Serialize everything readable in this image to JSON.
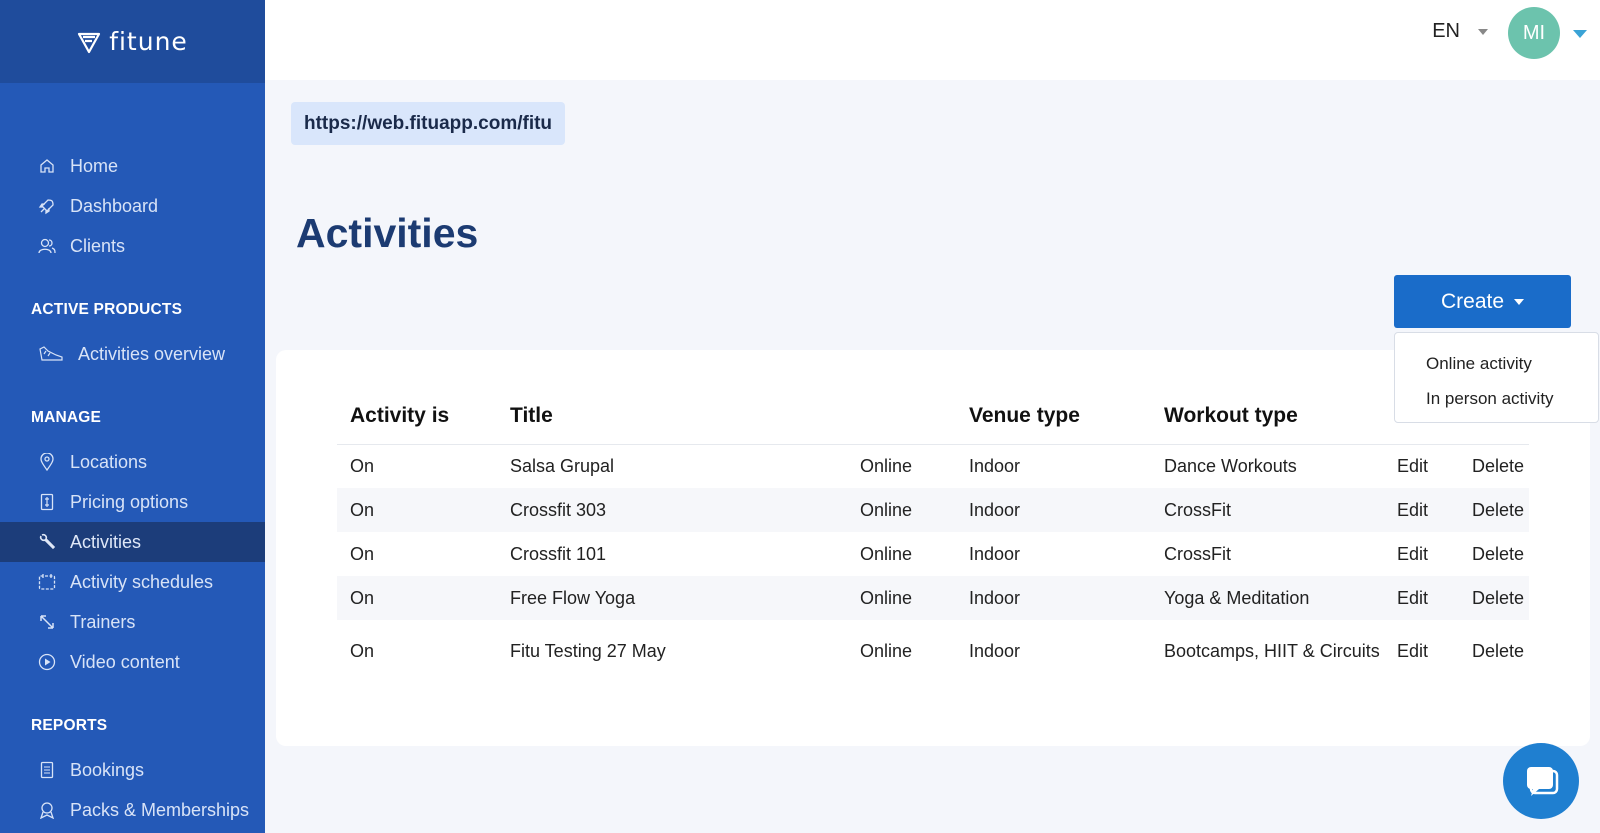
{
  "brand": {
    "name": "fitune"
  },
  "topbar": {
    "language": "EN",
    "avatar_initials": "MI"
  },
  "sidebar": {
    "items_top": [
      {
        "label": "Home",
        "icon": "home-icon"
      },
      {
        "label": "Dashboard",
        "icon": "rocket-icon"
      },
      {
        "label": "Clients",
        "icon": "users-icon"
      }
    ],
    "section_active_products": "ACTIVE PRODUCTS",
    "items_products": [
      {
        "label": "Activities overview",
        "icon": "sneaker-icon"
      }
    ],
    "section_manage": "MANAGE",
    "items_manage": [
      {
        "label": "Locations",
        "icon": "location-pin-icon"
      },
      {
        "label": "Pricing options",
        "icon": "price-tag-icon"
      },
      {
        "label": "Activities",
        "icon": "wrench-icon",
        "active": true
      },
      {
        "label": "Activity schedules",
        "icon": "calendar-icon"
      },
      {
        "label": "Trainers",
        "icon": "expand-arrows-icon"
      },
      {
        "label": "Video content",
        "icon": "play-circle-icon"
      }
    ],
    "section_reports": "REPORTS",
    "items_reports": [
      {
        "label": "Bookings",
        "icon": "clipboard-icon"
      },
      {
        "label": "Packs & Memberships",
        "icon": "award-icon"
      }
    ]
  },
  "main": {
    "url": "https://web.fituapp.com/fitu",
    "title": "Activities",
    "create_label": "Create",
    "create_menu": [
      "Online activity",
      "In person activity"
    ]
  },
  "table": {
    "headers": [
      "Activity is",
      "Title",
      "",
      "Venue type",
      "Workout type",
      "",
      ""
    ],
    "rows": [
      {
        "status": "On",
        "title": "Salsa Grupal",
        "mode": "Online",
        "venue": "Indoor",
        "workout": "Dance Workouts",
        "edit": "Edit",
        "delete": "Delete"
      },
      {
        "status": "On",
        "title": "Crossfit 303",
        "mode": "Online",
        "venue": "Indoor",
        "workout": "CrossFit",
        "edit": "Edit",
        "delete": "Delete"
      },
      {
        "status": "On",
        "title": "Crossfit 101",
        "mode": "Online",
        "venue": "Indoor",
        "workout": "CrossFit",
        "edit": "Edit",
        "delete": "Delete"
      },
      {
        "status": "On",
        "title": "Free Flow Yoga",
        "mode": "Online",
        "venue": "Indoor",
        "workout": "Yoga & Meditation",
        "edit": "Edit",
        "delete": "Delete"
      },
      {
        "status": "On",
        "title": "Fitu Testing 27 May",
        "mode": "Online",
        "venue": "Indoor",
        "workout": "Bootcamps, HIIT & Circuits",
        "edit": "Edit",
        "delete": "Delete"
      }
    ]
  },
  "colors": {
    "sidebar": "#2459b7",
    "sidebar_active": "#1c3d7a",
    "primary_button": "#1a6cc9",
    "title": "#1c3b72",
    "avatar": "#6cc3ad"
  }
}
